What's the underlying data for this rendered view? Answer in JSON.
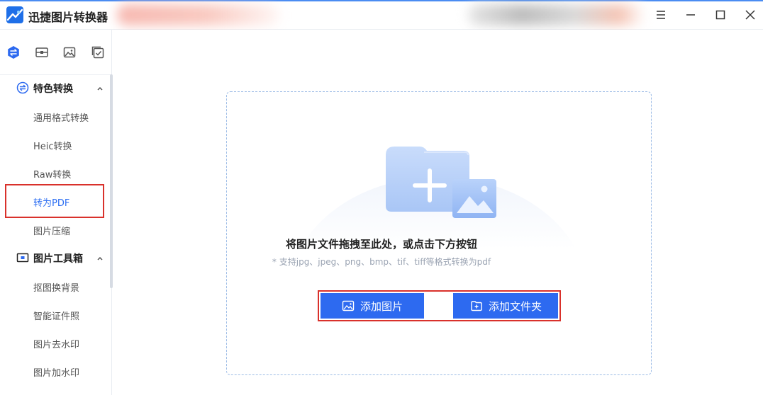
{
  "app": {
    "title": "迅捷图片转换器",
    "accent": "#2d6af0"
  },
  "window_controls": [
    "menu-icon",
    "minimize-icon",
    "maximize-icon",
    "close-icon"
  ],
  "sidebar": {
    "top_icons": [
      "convert-icon",
      "toolbox-icon",
      "image-edit-icon",
      "batch-icon"
    ],
    "sections": [
      {
        "label": "特色转换",
        "icon": "convert-icon",
        "expanded": true,
        "items": [
          "通用格式转换",
          "Heic转换",
          "Raw转换",
          "转为PDF",
          "图片压缩"
        ]
      },
      {
        "label": "图片工具箱",
        "icon": "toolbox-icon",
        "expanded": true,
        "items": [
          "抠图换背景",
          "智能证件照",
          "图片去水印",
          "图片加水印"
        ]
      }
    ],
    "active_item": "转为PDF"
  },
  "dropzone": {
    "title": "将图片文件拖拽至此处，或点击下方按钮",
    "hint": "* 支持jpg、jpeg、png、bmp、tif、tiff等格式转换为pdf",
    "add_image_label": "添加图片",
    "add_folder_label": "添加文件夹"
  },
  "highlight_color": "#d9312b"
}
